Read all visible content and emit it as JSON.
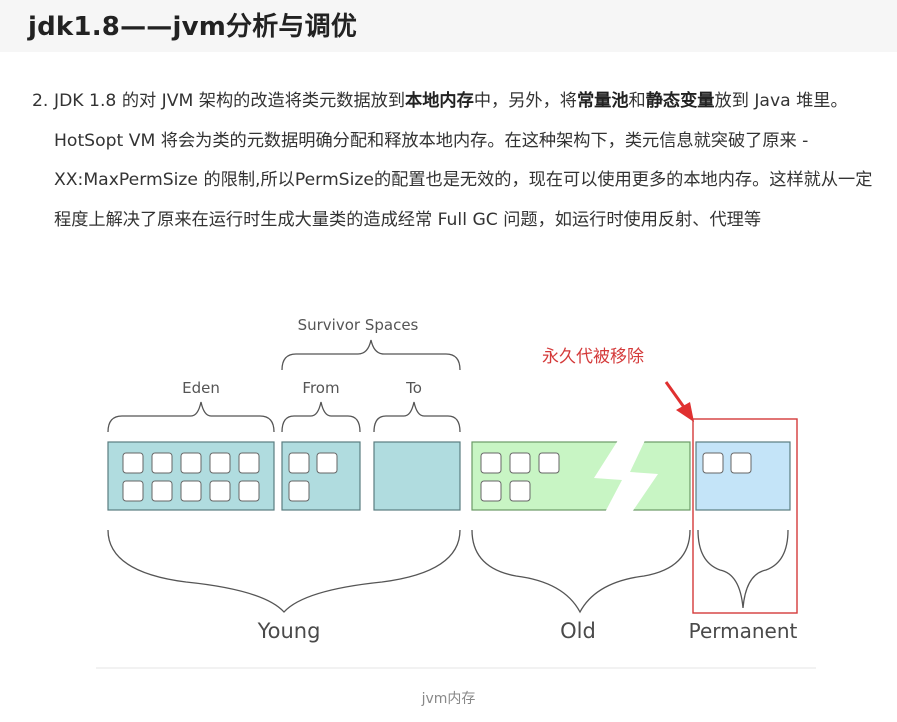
{
  "header": {
    "title": "jdk1.8——jvm分析与调优"
  },
  "paragraph": {
    "number": "2.",
    "t1": "JDK 1.8 的对 JVM 架构的改造将类元数据放到",
    "b1": "本地内存",
    "t2": "中，另外，将",
    "b2": "常量池",
    "t3": "和",
    "b3": "静态变量",
    "t4": "放到 Java 堆里。HotSopt VM 将会为类的元数据明确分配和释放本地内存。在这种架构下，类元信息就突破了原来 -XX:MaxPermSize 的限制,所以PermSize的配置也是无效的，现在可以使用更多的本地内存。这样就从一定程度上解决了原来在运行时生成大量类的造成经常 Full GC 问题，如运行时使用反射、代理等"
  },
  "diagram": {
    "survivor_label": "Survivor Spaces",
    "eden_label": "Eden",
    "from_label": "From",
    "to_label": "To",
    "removed_note": "永久代被移除",
    "young_label": "Young",
    "old_label": "Old",
    "permanent_label": "Permanent",
    "colors": {
      "young": "#b0dcdf",
      "old": "#c8f5c4",
      "permanent": "#c4e4f8",
      "note": "#d43a3a"
    }
  },
  "caption": "jvm内存"
}
